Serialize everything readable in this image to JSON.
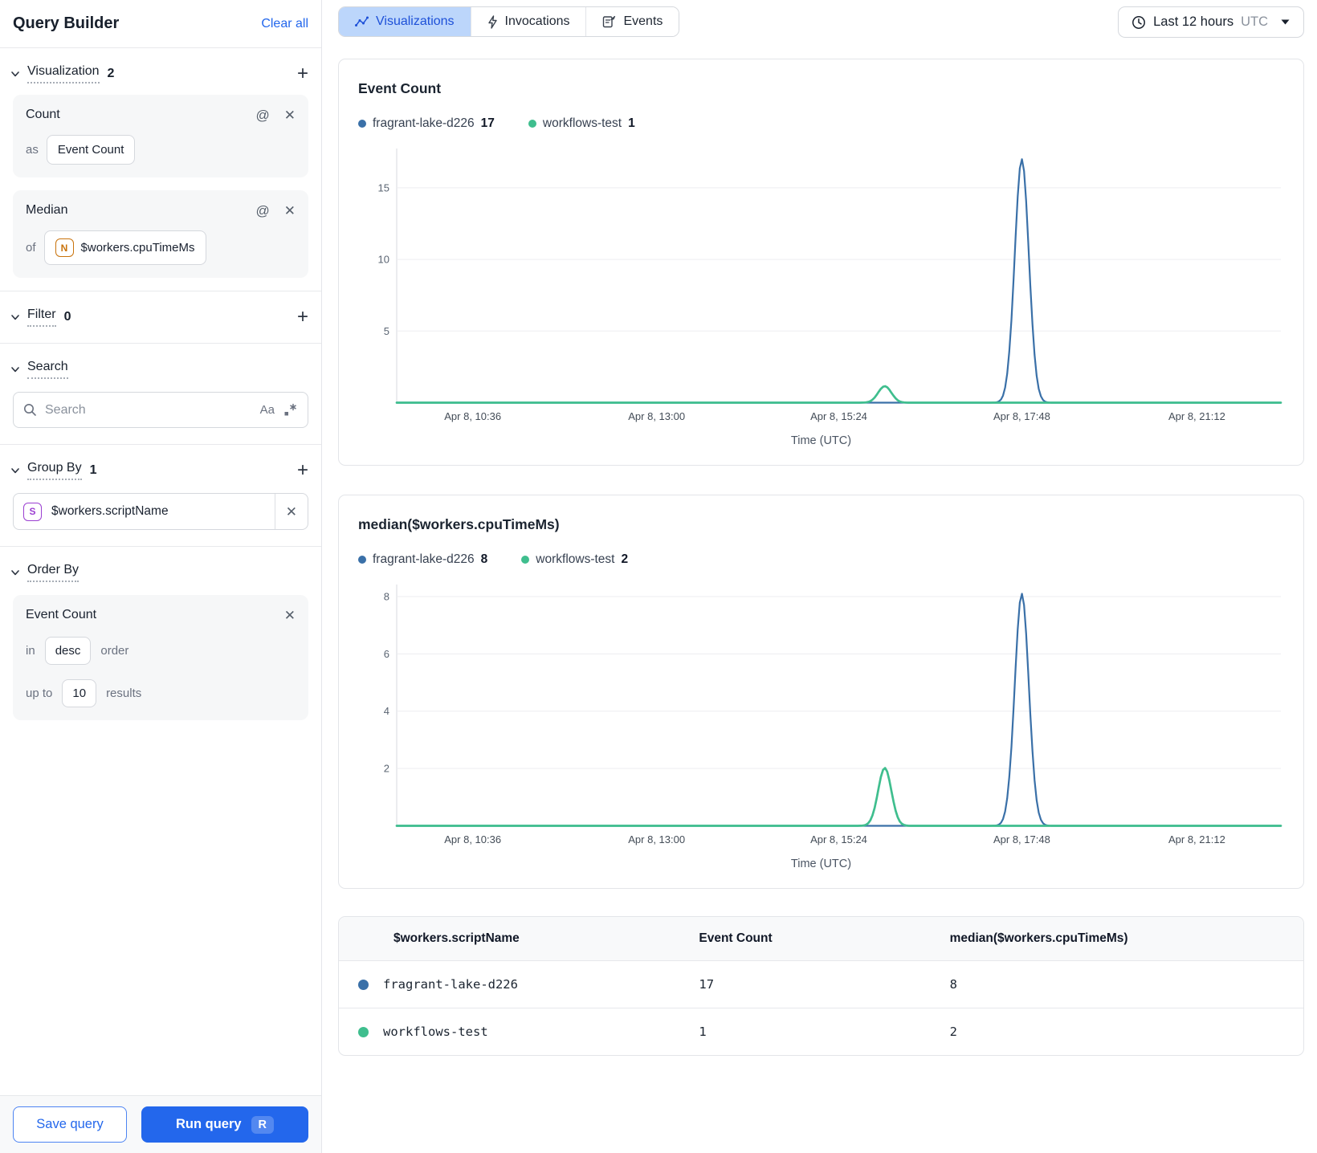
{
  "colors": {
    "blue": "#3A70A8",
    "green": "#3FBE8E",
    "accent_blue": "#2367EC",
    "active_tab_bg": "#BCD6FB",
    "active_tab_text": "#1D50D8"
  },
  "sidebar": {
    "title": "Query Builder",
    "clear_all_label": "Clear all",
    "visualization": {
      "label": "Visualization",
      "count": "2"
    },
    "count_card": {
      "title": "Count",
      "as_label": "as",
      "value": "Event Count"
    },
    "median_card": {
      "title": "Median",
      "of_label": "of",
      "type_letter": "N",
      "value": "$workers.cpuTimeMs"
    },
    "filter": {
      "label": "Filter",
      "count": "0"
    },
    "search": {
      "label": "Search",
      "placeholder": "Search",
      "case_icon": "Aa"
    },
    "group_by": {
      "label": "Group By",
      "count": "1",
      "item": {
        "type_letter": "S",
        "value": "$workers.scriptName"
      }
    },
    "order_by": {
      "label": "Order By",
      "field": "Event Count",
      "in_label": "in",
      "direction": "desc",
      "order_label": "order",
      "up_to_label": "up to",
      "limit": "10",
      "results_label": "results"
    },
    "save_label": "Save query",
    "run_label": "Run query",
    "run_shortcut": "R"
  },
  "toolbar": {
    "tabs": [
      {
        "label": "Visualizations",
        "active": true
      },
      {
        "label": "Invocations",
        "active": false
      },
      {
        "label": "Events",
        "active": false
      }
    ],
    "time_range": {
      "label": "Last 12 hours",
      "timezone": "UTC"
    }
  },
  "chart_data": [
    {
      "type": "line",
      "title": "Event Count",
      "xlabel": "Time (UTC)",
      "ylim": [
        0,
        17.6
      ],
      "y_ticks": [
        5,
        10,
        15
      ],
      "x_ticks": [
        {
          "pos": 0.086,
          "label": "Apr 8, 10:36"
        },
        {
          "pos": 0.294,
          "label": "Apr 8, 13:00"
        },
        {
          "pos": 0.5,
          "label": "Apr 8, 15:24"
        },
        {
          "pos": 0.707,
          "label": "Apr 8, 17:48"
        },
        {
          "pos": 0.905,
          "label": "Apr 8, 21:12"
        }
      ],
      "series": [
        {
          "name": "fragrant-lake-d226",
          "color": "blue",
          "legend_value": "17",
          "baseline": 0,
          "spike": {
            "center": 0.707,
            "sigma": 0.008,
            "peak": 17
          }
        },
        {
          "name": "workflows-test",
          "color": "green",
          "legend_value": "1",
          "baseline": 0,
          "spike": {
            "center": 0.552,
            "sigma": 0.0075,
            "peak": 1.15
          }
        }
      ]
    },
    {
      "type": "line",
      "title": "median($workers.cpuTimeMs)",
      "xlabel": "Time (UTC)",
      "ylim": [
        0,
        8.35
      ],
      "y_ticks": [
        2,
        4,
        6,
        8
      ],
      "x_ticks": [
        {
          "pos": 0.086,
          "label": "Apr 8, 10:36"
        },
        {
          "pos": 0.294,
          "label": "Apr 8, 13:00"
        },
        {
          "pos": 0.5,
          "label": "Apr 8, 15:24"
        },
        {
          "pos": 0.707,
          "label": "Apr 8, 17:48"
        },
        {
          "pos": 0.905,
          "label": "Apr 8, 21:12"
        }
      ],
      "series": [
        {
          "name": "fragrant-lake-d226",
          "color": "blue",
          "legend_value": "8",
          "baseline": 0,
          "spike": {
            "center": 0.707,
            "sigma": 0.008,
            "peak": 8.1
          }
        },
        {
          "name": "workflows-test",
          "color": "green",
          "legend_value": "2",
          "baseline": 0,
          "spike": {
            "center": 0.552,
            "sigma": 0.0075,
            "peak": 2.02
          }
        }
      ]
    }
  ],
  "table": {
    "headers": [
      "$workers.scriptName",
      "Event Count",
      "median($workers.cpuTimeMs)"
    ],
    "rows": [
      {
        "color": "blue",
        "name": "fragrant-lake-d226",
        "event_count": "17",
        "median": "8"
      },
      {
        "color": "green",
        "name": "workflows-test",
        "event_count": "1",
        "median": "2"
      }
    ]
  }
}
